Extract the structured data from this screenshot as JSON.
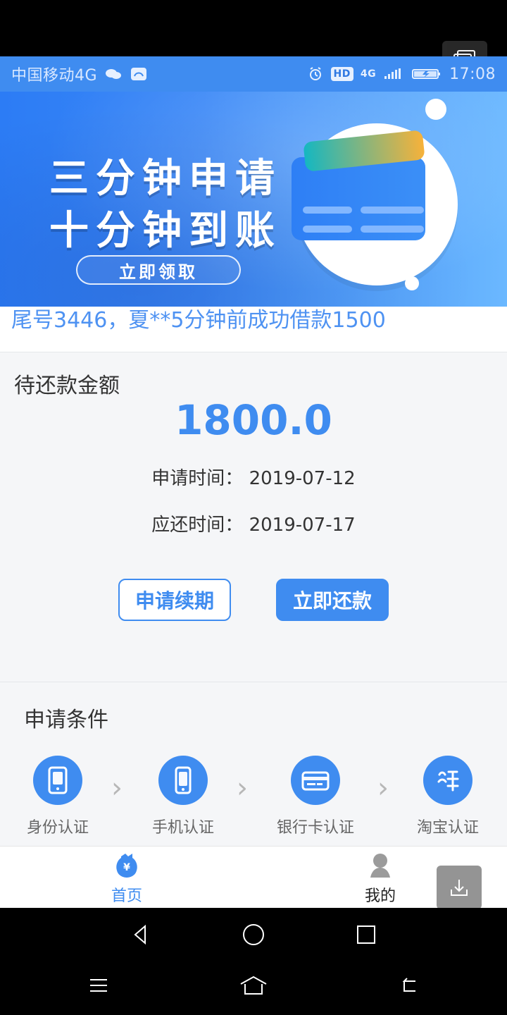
{
  "status_bar": {
    "carrier": "中国移动4G",
    "time": "17:08",
    "hd": "HD",
    "network": "4G"
  },
  "banner": {
    "line1": "三分钟申请",
    "line2": "十分钟到账",
    "cta": "立即领取"
  },
  "ticker": {
    "line1": "尾号3446，夏**5分钟前成功借款1500"
  },
  "repayment": {
    "title": "待还款金额",
    "amount": "1800.0",
    "apply_time_label": "申请时间：",
    "apply_time": "2019-07-12",
    "due_time_label": "应还时间：",
    "due_time": "2019-07-17",
    "renew_button": "申请续期",
    "pay_button": "立即还款"
  },
  "conditions": {
    "title": "申请条件",
    "steps": [
      {
        "label": "身份认证",
        "icon": "id-phone-icon"
      },
      {
        "label": "手机认证",
        "icon": "phone-icon"
      },
      {
        "label": "银行卡认证",
        "icon": "bank-card-icon"
      },
      {
        "label": "淘宝认证",
        "icon": "taobao-icon"
      }
    ]
  },
  "tabbar": {
    "home": "首页",
    "mine": "我的"
  },
  "colors": {
    "blue": "#3f8cf0"
  }
}
